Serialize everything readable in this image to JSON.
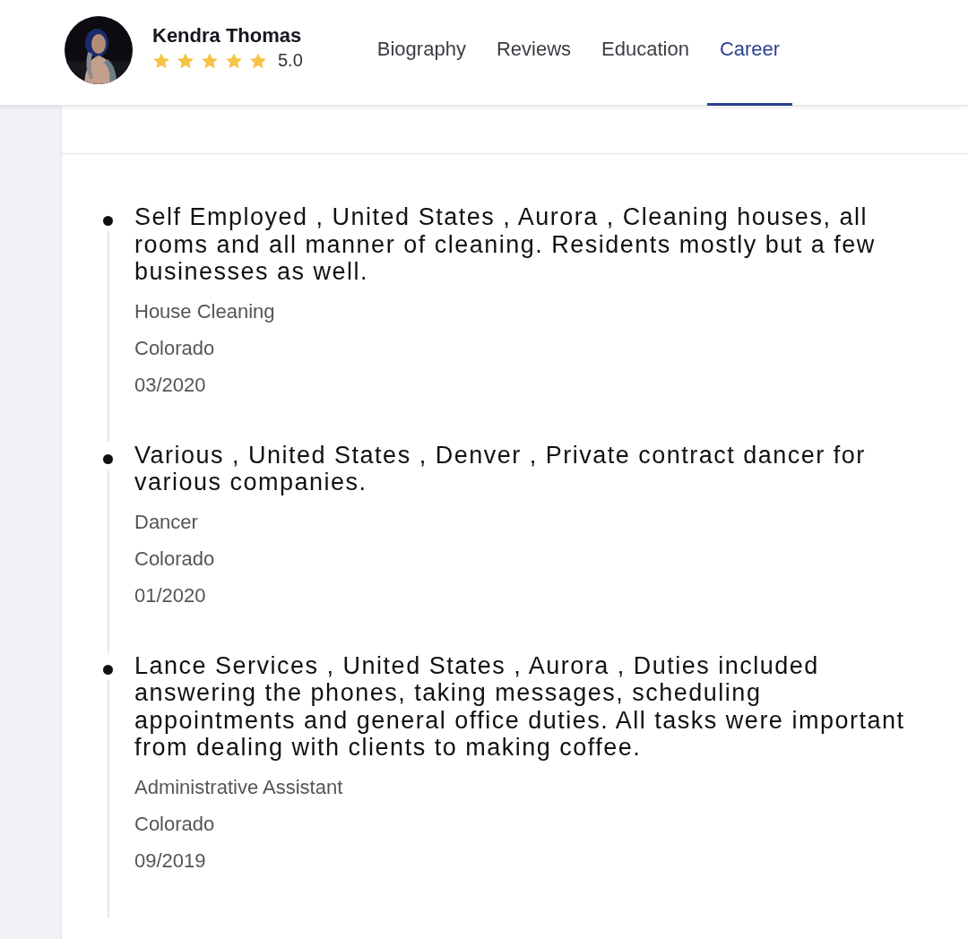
{
  "profile": {
    "name": "Kendra Thomas",
    "stars": 5,
    "rating": "5.0"
  },
  "tabs": [
    {
      "label": "Biography",
      "selected": false
    },
    {
      "label": "Reviews",
      "selected": false
    },
    {
      "label": "Education",
      "selected": false
    },
    {
      "label": "Career",
      "selected": true
    }
  ],
  "career": [
    {
      "title": "Self Employed , United States , Aurora , Cleaning houses, all rooms and all manner of cleaning. Residents mostly but a few businesses as well.",
      "role": "House Cleaning",
      "location": "Colorado",
      "date": "03/2020"
    },
    {
      "title": "Various , United States , Denver , Private contract dancer for various companies.",
      "role": "Dancer",
      "location": "Colorado",
      "date": "01/2020"
    },
    {
      "title": "Lance Services , United States , Aurora , Duties included answering the phones, taking messages, scheduling appointments and general office duties. All tasks were important from dealing with clients to making coffee.",
      "role": "Administrative Assistant",
      "location": "Colorado",
      "date": "09/2019"
    }
  ]
}
